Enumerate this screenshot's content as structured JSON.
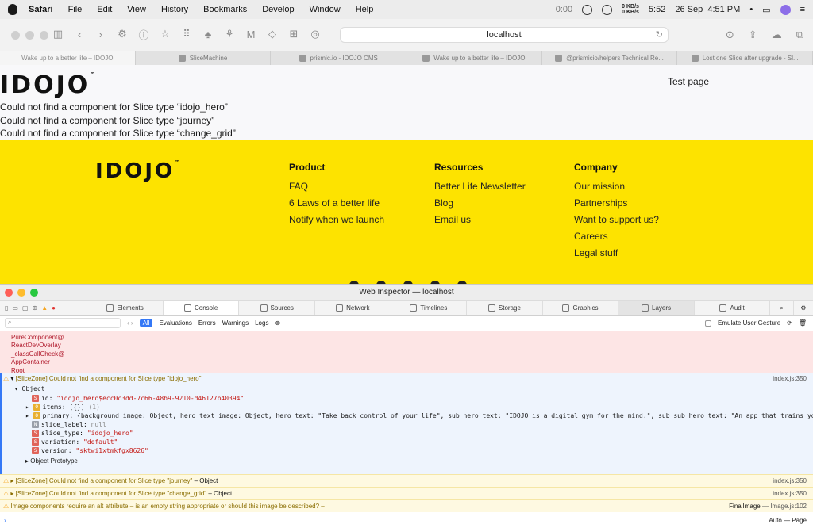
{
  "menubar": {
    "app": "Safari",
    "items": [
      "File",
      "Edit",
      "View",
      "History",
      "Bookmarks",
      "Develop",
      "Window",
      "Help"
    ],
    "timer": "0:00",
    "net_up": "0 KB/s",
    "net_down": "0 KB/s",
    "battery_time": "5:52",
    "date": "26 Sep",
    "time": "4:51 PM"
  },
  "toolbar": {
    "url": "localhost"
  },
  "tabs": [
    "Wake up to a better life – IDOJO",
    "SliceMachine",
    "prismic.io - IDOJO CMS",
    "Wake up to a better life – IDOJO",
    "@prismicio/helpers Technical Re...",
    "Lost one Slice after upgrade - Sl..."
  ],
  "page": {
    "logo": "IDOJO",
    "logo_tm": "™",
    "nav_link": "Test page",
    "errors": [
      "Could not find a component for Slice type “idojo_hero”",
      "Could not find a component for Slice type “journey”",
      "Could not find a component for Slice type “change_grid”"
    ]
  },
  "footer": {
    "logo": "IDOJO",
    "logo_tm": "™",
    "columns": [
      {
        "title": "Product",
        "links": [
          "FAQ",
          "6 Laws of a better life",
          "Notify when we launch"
        ]
      },
      {
        "title": "Resources",
        "links": [
          "Better Life Newsletter",
          "Blog",
          "Email us"
        ]
      },
      {
        "title": "Company",
        "links": [
          "Our mission",
          "Partnerships",
          "Want to support us?",
          "Careers",
          "Legal stuff"
        ]
      }
    ]
  },
  "inspector": {
    "title": "Web Inspector — localhost",
    "tabs": [
      "Elements",
      "Console",
      "Sources",
      "Network",
      "Timelines",
      "Storage",
      "Graphics",
      "Layers",
      "Audit"
    ],
    "filter": {
      "all": "All",
      "types": [
        "Evaluations",
        "Errors",
        "Warnings",
        "Logs"
      ],
      "emulate": "Emulate User Gesture"
    },
    "stack": [
      "PureComponent@",
      "ReactDevOverlay",
      "_classCallCheck@",
      "AppContainer",
      "Root"
    ],
    "object": {
      "header": "[SliceZone] Could not find a component for Slice type \"idojo_hero\"",
      "source": "index.js:350",
      "object_label": "Object",
      "id_key": "id:",
      "id_val": "\"idojo_hero$ecc0c3dd-7c66-48b9-9210-d46127b40394\"",
      "items_key": "items:",
      "items_val": "[{}]",
      "items_count": "(1)",
      "primary_key": "primary:",
      "primary_val": "{background_image: Object, hero_text_image: Object, hero_text: \"Take back control of your life\", sub_hero_text: \"IDOJO is a digital gym for the mind.\", sub_sub_hero_text: \"An app that trains your abili",
      "slice_label_key": "slice_label:",
      "slice_label_val": "null",
      "slice_type_key": "slice_type:",
      "slice_type_val": "\"idojo_hero\"",
      "variation_key": "variation:",
      "variation_val": "\"default\"",
      "version_key": "version:",
      "version_val": "\"sktwi1xtmkfgx8626\"",
      "proto": "Object Prototype"
    },
    "messages": [
      {
        "text": "[SliceZone] Could not find a component for Slice type \"journey\"",
        "obj": "– Object",
        "source": "index.js:350"
      },
      {
        "text": "[SliceZone] Could not find a component for Slice type \"change_grid\"",
        "obj": "– Object",
        "source": "index.js:350"
      },
      {
        "text": "Image components require an alt attribute – is an empty string appropriate or should this image be described? –",
        "obj": "FinalImage",
        "source": "— Image.js:102"
      }
    ],
    "prompt_right": "Auto — Page"
  }
}
